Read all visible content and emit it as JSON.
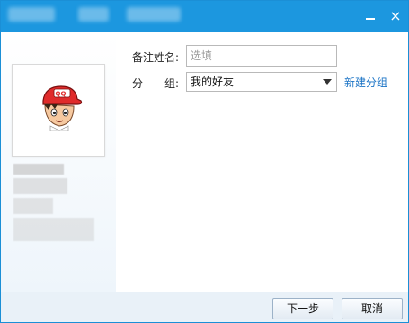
{
  "window": {
    "minimize_glyph": "minimize-icon",
    "close_glyph": "×"
  },
  "form": {
    "remark_label": "备注姓名:",
    "remark_placeholder": "选填",
    "remark_value": "",
    "group_label": "分　　组:",
    "group_selected": "我的好友",
    "new_group_link": "新建分组"
  },
  "footer": {
    "next_label": "下一步",
    "cancel_label": "取消"
  },
  "colors": {
    "titlebar": "#1c97df",
    "link": "#1a73c5",
    "footer_bg": "#e9f1f8"
  }
}
